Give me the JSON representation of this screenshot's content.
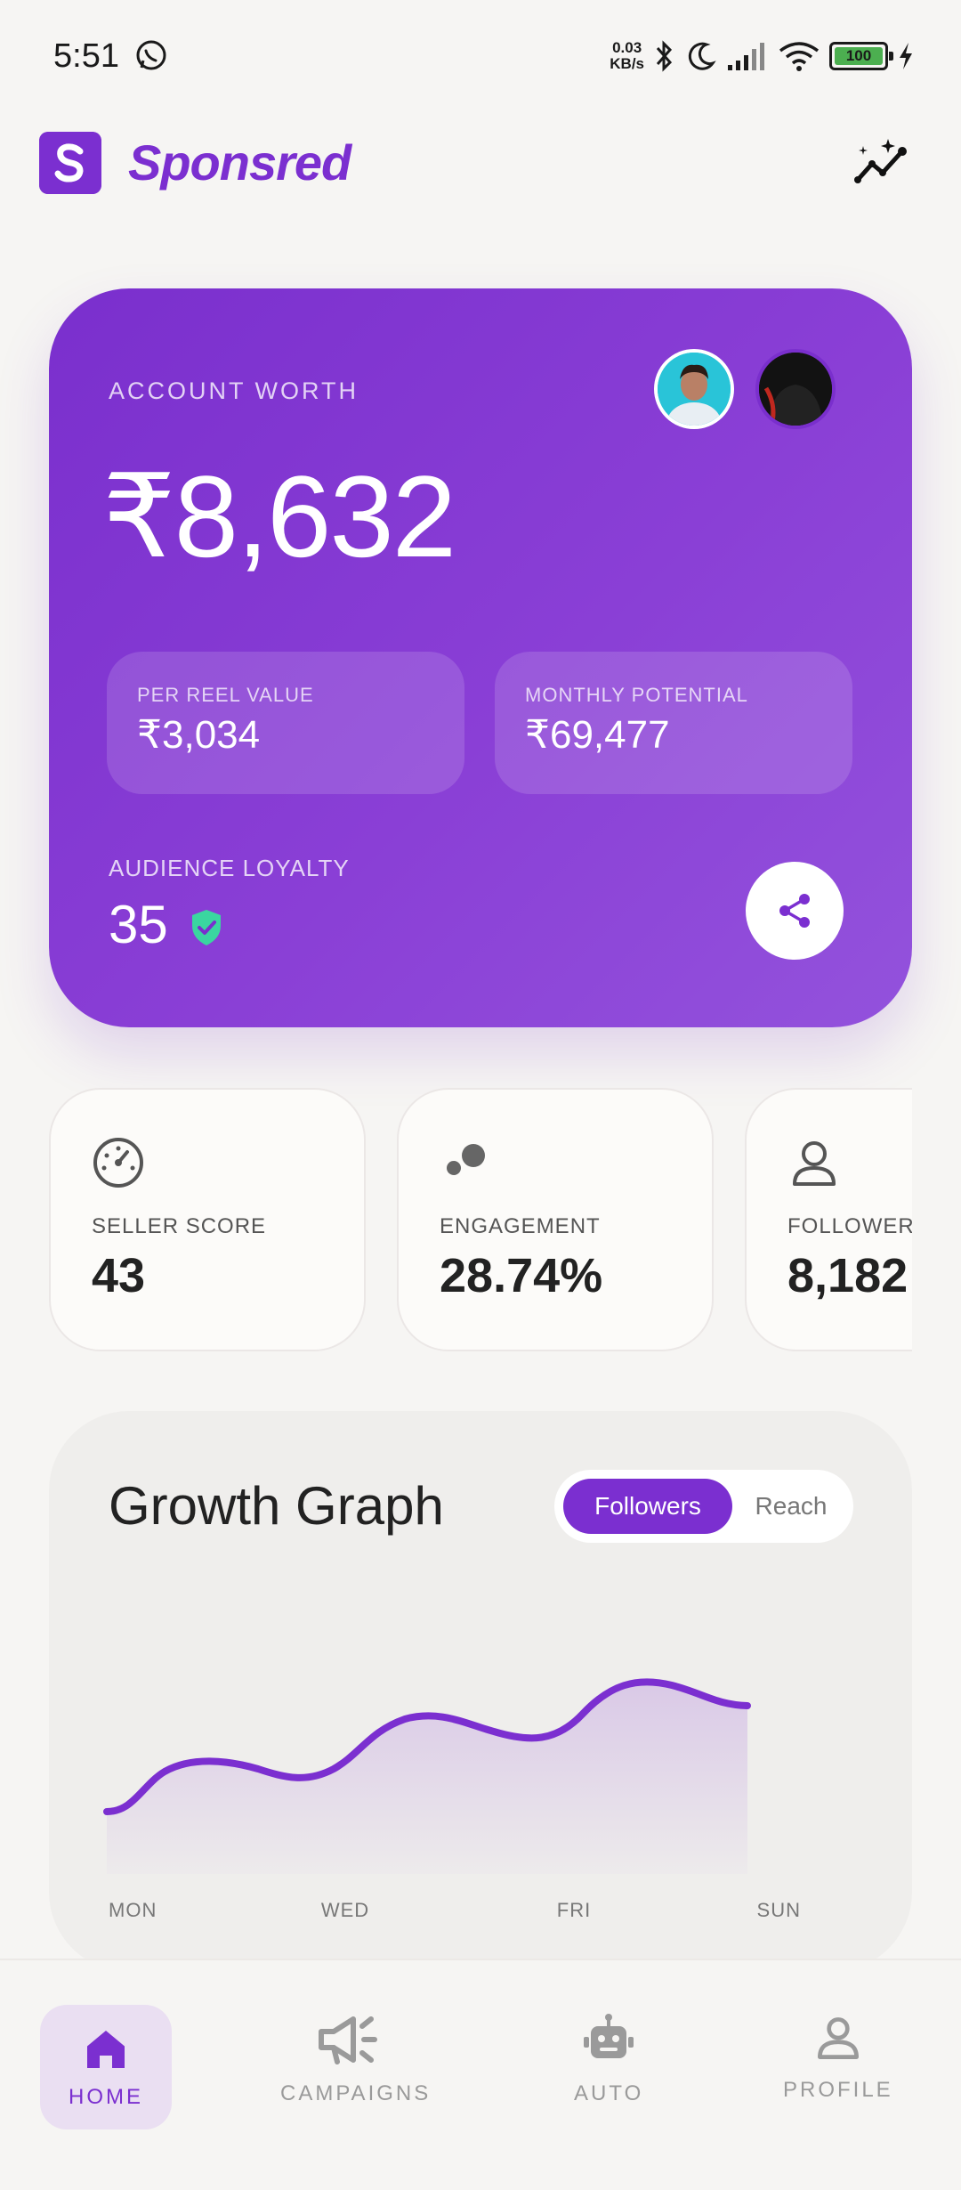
{
  "status_bar": {
    "time": "5:51",
    "net_speed_value": "0.03",
    "net_speed_unit": "KB/s",
    "battery": "100",
    "icons": [
      "whatsapp-icon",
      "bluetooth-icon",
      "moon-icon",
      "signal-icon",
      "wifi-icon",
      "charging-icon"
    ]
  },
  "header": {
    "brand": "Sponsred",
    "logo_icon": "s-logo-icon",
    "action_icon": "analytics-sparkle-icon"
  },
  "worth_card": {
    "label": "ACCOUNT WORTH",
    "value": "₹8,632",
    "per_reel_label": "PER REEL VALUE",
    "per_reel_value": "₹3,034",
    "monthly_label": "MONTHLY POTENTIAL",
    "monthly_value": "₹69,477",
    "loyalty_label": "AUDIENCE LOYALTY",
    "loyalty_value": "35",
    "colors": {
      "gradient_start": "#7a2fcd",
      "gradient_end": "#9352dc",
      "shield": "#3ad6a0"
    }
  },
  "metrics": [
    {
      "label": "SELLER SCORE",
      "value": "43",
      "icon": "speedometer-icon"
    },
    {
      "label": "ENGAGEMENT",
      "value": "28.74%",
      "icon": "bubbles-icon"
    },
    {
      "label": "FOLLOWERS",
      "value": "8,182",
      "icon": "person-icon"
    }
  ],
  "growth": {
    "title": "Growth Graph",
    "toggle_active": "Followers",
    "toggle_inactive": "Reach"
  },
  "chart_data": {
    "type": "area",
    "x_ticks": [
      "MON",
      "WED",
      "FRI",
      "SUN"
    ],
    "line_color": "#7b2fd0"
  },
  "bottom_nav": {
    "items": [
      {
        "label": "HOME",
        "icon": "home-icon",
        "active": true
      },
      {
        "label": "CAMPAIGNS",
        "icon": "megaphone-icon",
        "active": false
      },
      {
        "label": "AUTO",
        "icon": "robot-icon",
        "active": false
      },
      {
        "label": "PROFILE",
        "icon": "profile-icon",
        "active": false
      }
    ]
  },
  "colors": {
    "accent": "#7b2fd0",
    "background": "#f6f5f3"
  }
}
